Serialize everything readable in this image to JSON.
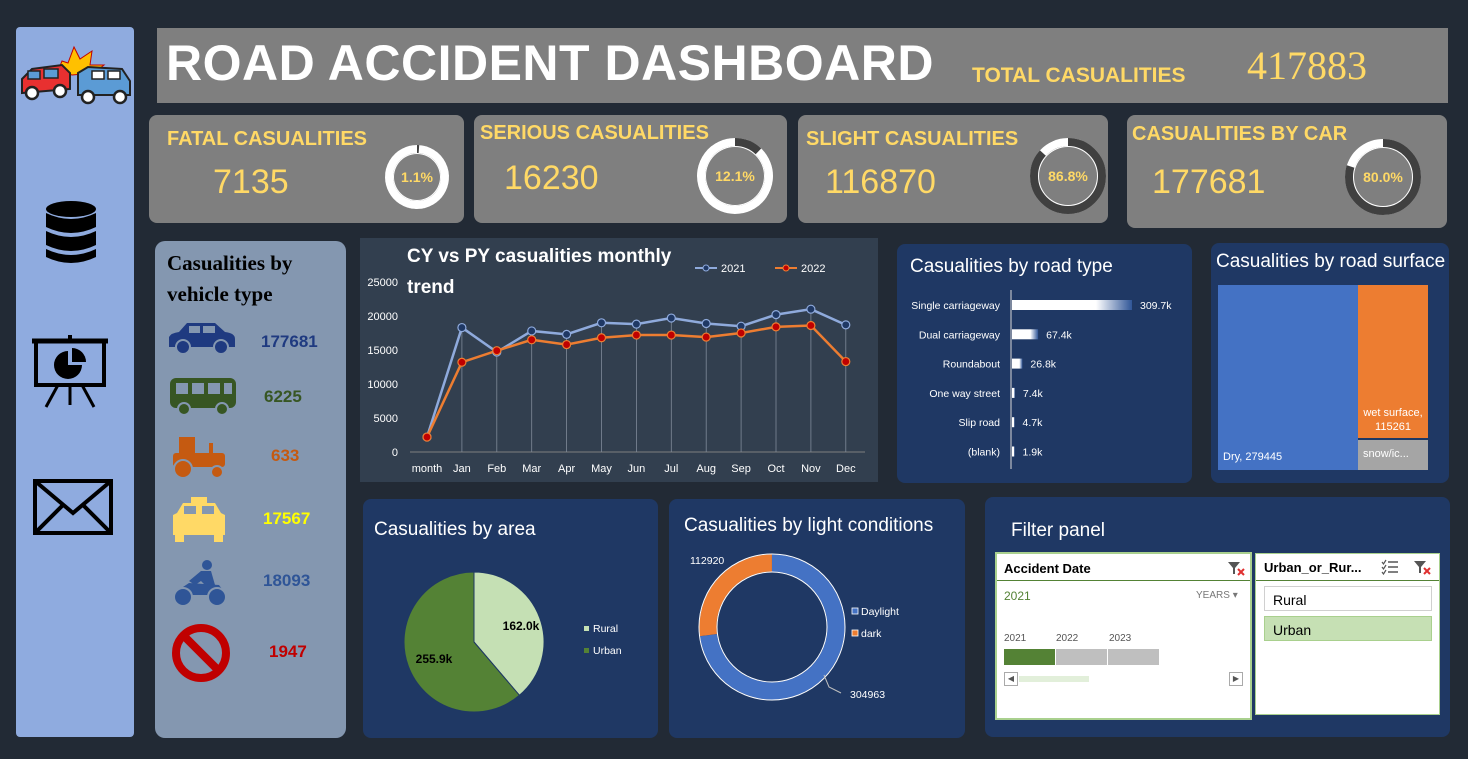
{
  "header": {
    "title": "ROAD ACCIDENT DASHBOARD",
    "total_label": "TOTAL CASUALITIES",
    "total_value": "417883"
  },
  "sidebar": {
    "icons": [
      "car-crash-icon",
      "database-icon",
      "presentation-icon",
      "mail-icon"
    ]
  },
  "kpis": [
    {
      "label": "FATAL CASUALITIES",
      "value": "7135",
      "pct": "1.1%",
      "fraction": 0.011
    },
    {
      "label": "SERIOUS CASUALITIES",
      "value": "16230",
      "pct": "12.1%",
      "fraction": 0.121
    },
    {
      "label": "SLIGHT CASUALITIES",
      "value": "116870",
      "pct": "86.8%",
      "fraction": 0.868
    },
    {
      "label": "CASUALITIES BY CAR",
      "value": "177681",
      "pct": "80.0%",
      "fraction": 0.8
    }
  ],
  "vehicle": {
    "title": "Casualities by vehicle type",
    "items": [
      {
        "icon": "car-icon",
        "value": "177681",
        "color": "#1f3a80"
      },
      {
        "icon": "bus-icon",
        "value": "6225",
        "color": "#375623"
      },
      {
        "icon": "tractor-icon",
        "value": "633",
        "color": "#c55a11"
      },
      {
        "icon": "taxi-icon",
        "value": "17567",
        "color": "#ffff00"
      },
      {
        "icon": "motorbike-icon",
        "value": "18093",
        "color": "#2f5597"
      },
      {
        "icon": "no-entry-icon",
        "value": "1947",
        "color": "#c00000"
      }
    ]
  },
  "chart_data": [
    {
      "type": "line",
      "title": "CY vs PY casualities monthly trend",
      "categories": [
        "month",
        "Jan",
        "Feb",
        "Mar",
        "Apr",
        "May",
        "Jun",
        "Jul",
        "Aug",
        "Sep",
        "Oct",
        "Nov",
        "Dec"
      ],
      "series": [
        {
          "name": "2021",
          "color": "#8faadc",
          "values": [
            2200,
            18300,
            14700,
            17800,
            17300,
            19000,
            18800,
            19700,
            18900,
            18500,
            20200,
            21000,
            18700
          ]
        },
        {
          "name": "2022",
          "color": "#ed7d31",
          "values": [
            2200,
            13200,
            14900,
            16500,
            15800,
            16800,
            17200,
            17200,
            16900,
            17500,
            18400,
            18600,
            13300
          ]
        }
      ],
      "ylim": [
        0,
        25000
      ],
      "yticks": [
        "0",
        "5000",
        "10000",
        "15000",
        "20000",
        "25000"
      ]
    },
    {
      "type": "bar",
      "title": "Casualities by road type",
      "categories": [
        "Single carriageway",
        "Dual carriageway",
        "Roundabout",
        "One way street",
        "Slip road",
        "(blank)"
      ],
      "values": [
        309.7,
        67.4,
        26.8,
        7.4,
        4.7,
        1.9
      ],
      "labels": [
        "309.7k",
        "67.4k",
        "26.8k",
        "7.4k",
        "4.7k",
        "1.9k"
      ]
    },
    {
      "type": "heatmap",
      "title": "Casualities by road surface",
      "items": [
        {
          "name": "Dry",
          "value": 279445,
          "label": "Dry, 279445",
          "color": "#4472c4"
        },
        {
          "name": "wet surface",
          "value": 115261,
          "label1": "wet surface,",
          "label2": "115261",
          "color": "#ed7d31"
        },
        {
          "name": "snow/ic...",
          "label": "snow/ic...",
          "color": "#a5a5a5"
        }
      ]
    },
    {
      "type": "pie",
      "title": "Casualities by area",
      "slices": [
        {
          "name": "Rural",
          "value": 162.0,
          "label": "162.0k",
          "color": "#c5e0b4"
        },
        {
          "name": "Urban",
          "value": 255.9,
          "label": "255.9k",
          "color": "#548235"
        }
      ]
    },
    {
      "type": "pie",
      "title": "Casualities by light conditions",
      "slices": [
        {
          "name": "Daylight",
          "value": 304963,
          "label": "304963",
          "color": "#4472c4"
        },
        {
          "name": "dark",
          "value": 112920,
          "label": "112920",
          "color": "#ed7d31"
        }
      ]
    }
  ],
  "filter": {
    "title": "Filter panel",
    "date": {
      "title": "Accident Date",
      "selected": "2021",
      "level": "YEARS",
      "years": [
        "2021",
        "2022",
        "2023"
      ]
    },
    "area": {
      "title": "Urban_or_Rur...",
      "options": [
        "Rural",
        "Urban"
      ],
      "selected": "Urban"
    }
  }
}
